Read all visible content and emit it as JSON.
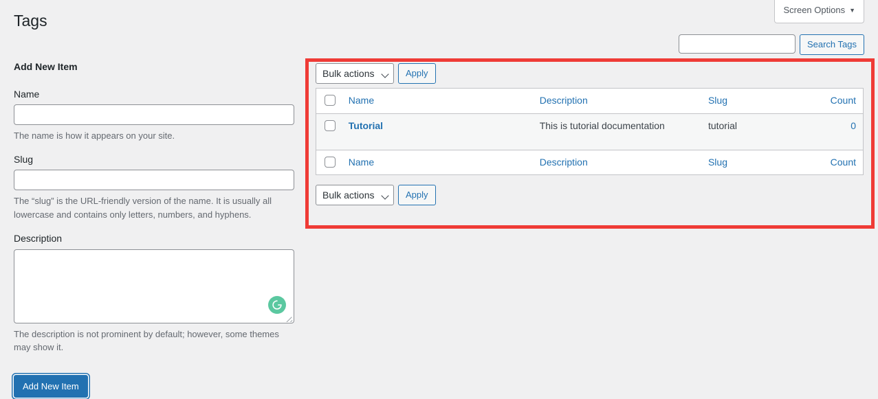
{
  "screen_meta": {
    "screen_options_label": "Screen Options",
    "caret_icon": "triangle-down-icon"
  },
  "page": {
    "title": "Tags"
  },
  "search": {
    "value": "",
    "placeholder": "",
    "button_label": "Search Tags"
  },
  "add_form": {
    "heading": "Add New Item",
    "name": {
      "label": "Name",
      "value": "",
      "help": "The name is how it appears on your site."
    },
    "slug": {
      "label": "Slug",
      "value": "",
      "help": "The “slug” is the URL-friendly version of the name. It is usually all lowercase and contains only letters, numbers, and hyphens."
    },
    "description": {
      "label": "Description",
      "value": "",
      "help": "The description is not prominent by default; however, some themes may show it.",
      "assistant_icon": "grammarly-icon",
      "resize_icon": "resize-grip-icon"
    },
    "submit_label": "Add New Item"
  },
  "tablenav": {
    "bulk_actions_label": "Bulk actions",
    "chevron_icon": "chevron-down-icon",
    "apply_label": "Apply"
  },
  "table": {
    "columns": {
      "checkbox": "select-all-checkbox",
      "name": "Name",
      "description": "Description",
      "slug": "Slug",
      "count": "Count"
    },
    "rows": [
      {
        "name": "Tutorial",
        "description": "This is tutorial documentation",
        "slug": "tutorial",
        "count": "0",
        "checkbox": "row-checkbox"
      }
    ]
  },
  "colors": {
    "highlight_border": "#ef3b36",
    "link": "#2271b1",
    "primary_button_bg": "#2271b1",
    "page_background": "#f0f0f1",
    "row_background": "#f6f7f7",
    "assistant_badge": "#5bc8a0"
  }
}
